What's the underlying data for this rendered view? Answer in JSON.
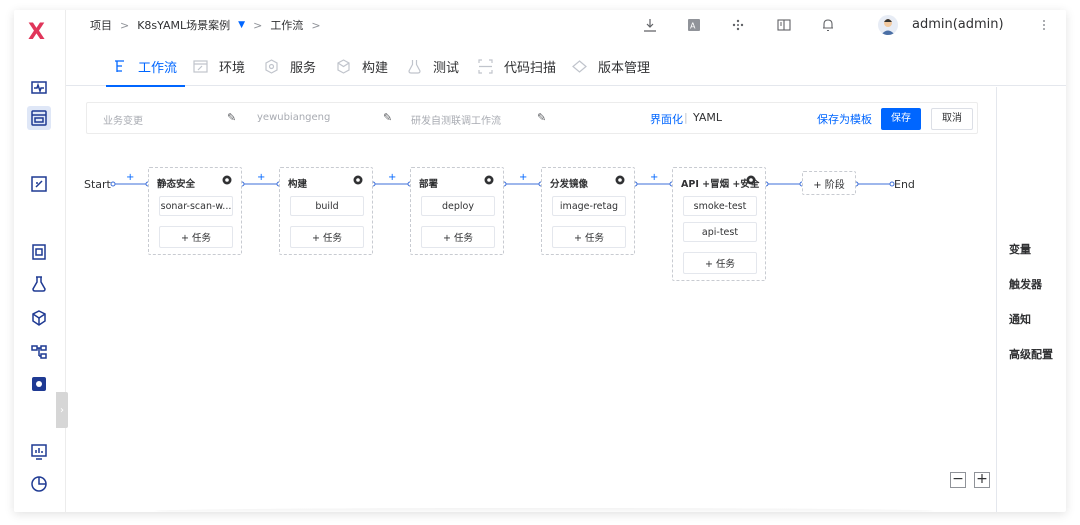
{
  "app": {
    "logo": "X"
  },
  "breadcrumb": {
    "project": "项目",
    "sep": ">",
    "pipeline": "K8sYAML场景案例",
    "caret": "▼",
    "workflow": "工作流"
  },
  "user": {
    "name": "admin(admin)"
  },
  "tabs": [
    {
      "label": "工作流",
      "icon": "workflow-icon",
      "active": true
    },
    {
      "label": "环境",
      "icon": "environment-icon"
    },
    {
      "label": "服务",
      "icon": "service-icon"
    },
    {
      "label": "构建",
      "icon": "build-icon"
    },
    {
      "label": "测试",
      "icon": "test-icon"
    },
    {
      "label": "代码扫描",
      "icon": "scan-icon"
    },
    {
      "label": "版本管理",
      "icon": "version-icon"
    }
  ],
  "header": {
    "field1_placeholder": "业务变更",
    "field2_placeholder": "yewubiangeng",
    "field3_placeholder": "研发自测联调工作流",
    "mode_ui": "界面化",
    "mode_divider": "|",
    "mode_yaml": "YAML",
    "save_template": "保存为模板",
    "save": "保存",
    "cancel": "取消"
  },
  "pipeline": {
    "start": "Start",
    "end": "End",
    "plus": "+",
    "add_stage": "+ 阶段",
    "add_task": "+ 任务",
    "stages": [
      {
        "name": "静态安全",
        "jobs": [
          "sonar-scan-w..."
        ]
      },
      {
        "name": "构建",
        "jobs": [
          "build"
        ]
      },
      {
        "name": "部署",
        "jobs": [
          "deploy"
        ]
      },
      {
        "name": "分发镜像",
        "jobs": [
          "image-retag"
        ]
      },
      {
        "name": "API +冒烟 +安全",
        "jobs": [
          "smoke-test",
          "api-test"
        ]
      }
    ]
  },
  "right_panel": {
    "items": [
      "变量",
      "触发器",
      "通知",
      "高级配置"
    ]
  },
  "zoom": {
    "minus": "−",
    "plus": "+"
  },
  "sidebar": {
    "toggle": "›"
  },
  "colors": {
    "accent": "#0066ff",
    "logo": "#e0365a",
    "sidebar_icon": "#1f3a93"
  }
}
